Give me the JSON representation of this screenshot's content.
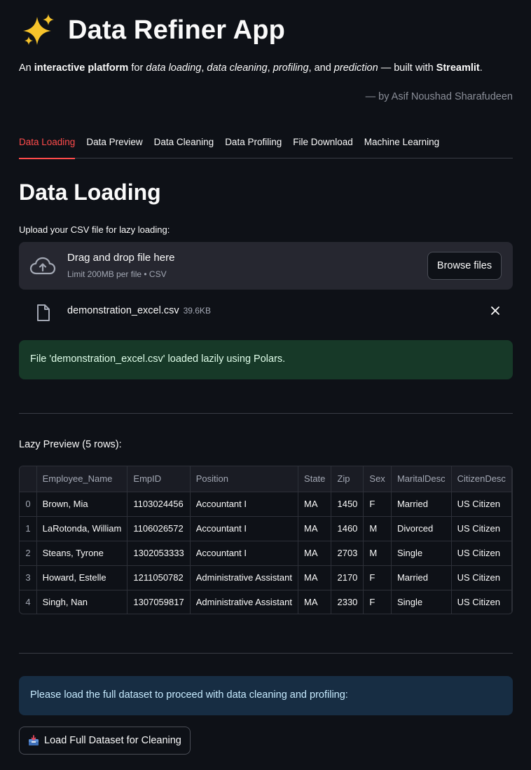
{
  "app": {
    "title": "Data Refiner App",
    "subtitle": {
      "p1": "An ",
      "b1": "interactive platform",
      "p2": " for ",
      "i1": "data loading",
      "p3": ", ",
      "i2": "data cleaning",
      "p4": ", ",
      "i3": "profiling",
      "p5": ", and ",
      "i4": "prediction",
      "p6": " — built with ",
      "b2": "Streamlit",
      "p7": "."
    },
    "author": "— by Asif Noushad Sharafudeen"
  },
  "tabs": [
    {
      "label": "Data Loading"
    },
    {
      "label": "Data Preview"
    },
    {
      "label": "Data Cleaning"
    },
    {
      "label": "Data Profiling"
    },
    {
      "label": "File Download"
    },
    {
      "label": "Machine Learning"
    }
  ],
  "section": {
    "title": "Data Loading",
    "upload_label": "Upload your CSV file for lazy loading:"
  },
  "uploader": {
    "drag_text": "Drag and drop file here",
    "limit_text": "Limit 200MB per file • CSV",
    "browse_label": "Browse files"
  },
  "file": {
    "name": "demonstration_excel.csv",
    "size": "39.6KB"
  },
  "success_message": "File 'demonstration_excel.csv' loaded lazily using Polars.",
  "preview": {
    "label": "Lazy Preview (5 rows):",
    "columns": [
      "",
      "Employee_Name",
      "EmpID",
      "Position",
      "State",
      "Zip",
      "Sex",
      "MaritalDesc",
      "CitizenDesc"
    ],
    "rows": [
      [
        "0",
        "Brown, Mia",
        "1103024456",
        "Accountant I",
        "MA",
        "1450",
        "F",
        "Married",
        "US Citizen"
      ],
      [
        "1",
        "LaRotonda, William",
        "1106026572",
        "Accountant I",
        "MA",
        "1460",
        "M",
        "Divorced",
        "US Citizen"
      ],
      [
        "2",
        "Steans, Tyrone",
        "1302053333",
        "Accountant I",
        "MA",
        "2703",
        "M",
        "Single",
        "US Citizen"
      ],
      [
        "3",
        "Howard, Estelle",
        "1211050782",
        "Administrative Assistant",
        "MA",
        "2170",
        "F",
        "Married",
        "US Citizen"
      ],
      [
        "4",
        "Singh, Nan",
        "1307059817",
        "Administrative Assistant",
        "MA",
        "2330",
        "F",
        "Single",
        "US Citizen"
      ]
    ]
  },
  "info_message": "Please load the full dataset to proceed with data cleaning and profiling:",
  "load_button": {
    "label": "Load Full Dataset for Cleaning"
  },
  "colors": {
    "background": "#0e1117",
    "accent": "#ff4b4b",
    "success_bg": "#173928",
    "info_bg": "#172d43"
  },
  "icons": {
    "title": "sparkles-icon",
    "upload": "cloud-upload-icon",
    "file": "file-icon",
    "remove": "close-icon",
    "button": "inbox-tray-icon"
  }
}
